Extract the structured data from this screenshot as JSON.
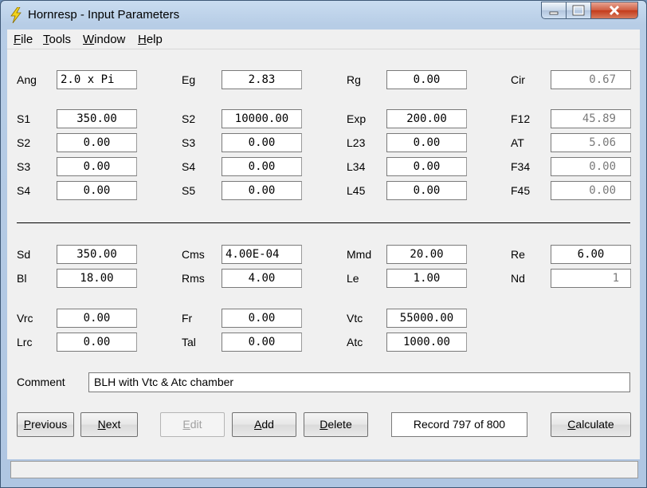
{
  "window": {
    "title": "Hornresp - Input Parameters"
  },
  "menu": [
    {
      "key": "F",
      "rest": "ile"
    },
    {
      "key": "T",
      "rest": "ools"
    },
    {
      "key": "W",
      "rest": "indow"
    },
    {
      "key": "H",
      "rest": "elp"
    }
  ],
  "fields": {
    "ang": {
      "label": "Ang",
      "value": "2.0 x Pi"
    },
    "eg": {
      "label": "Eg",
      "value": "2.83"
    },
    "rg": {
      "label": "Rg",
      "value": "0.00"
    },
    "cir": {
      "label": "Cir",
      "value": "0.67"
    },
    "s1": {
      "label": "S1",
      "value": "350.00"
    },
    "s2a": {
      "label": "S2",
      "value": "10000.00"
    },
    "exp": {
      "label": "Exp",
      "value": "200.00"
    },
    "f12": {
      "label": "F12",
      "value": "45.89"
    },
    "s2": {
      "label": "S2",
      "value": "0.00"
    },
    "s3a": {
      "label": "S3",
      "value": "0.00"
    },
    "l23": {
      "label": "L23",
      "value": "0.00"
    },
    "at": {
      "label": "AT",
      "value": "5.06"
    },
    "s3": {
      "label": "S3",
      "value": "0.00"
    },
    "s4a": {
      "label": "S4",
      "value": "0.00"
    },
    "l34": {
      "label": "L34",
      "value": "0.00"
    },
    "f34": {
      "label": "F34",
      "value": "0.00"
    },
    "s4": {
      "label": "S4",
      "value": "0.00"
    },
    "s5": {
      "label": "S5",
      "value": "0.00"
    },
    "l45": {
      "label": "L45",
      "value": "0.00"
    },
    "f45": {
      "label": "F45",
      "value": "0.00"
    },
    "sd": {
      "label": "Sd",
      "value": "350.00"
    },
    "cms": {
      "label": "Cms",
      "value": "4.00E-04"
    },
    "mmd": {
      "label": "Mmd",
      "value": "20.00"
    },
    "re": {
      "label": "Re",
      "value": "6.00"
    },
    "bl": {
      "label": "Bl",
      "value": "18.00"
    },
    "rms": {
      "label": "Rms",
      "value": "4.00"
    },
    "le": {
      "label": "Le",
      "value": "1.00"
    },
    "nd": {
      "label": "Nd",
      "value": "1"
    },
    "vrc": {
      "label": "Vrc",
      "value": "0.00"
    },
    "fr": {
      "label": "Fr",
      "value": "0.00"
    },
    "vtc": {
      "label": "Vtc",
      "value": "55000.00"
    },
    "lrc": {
      "label": "Lrc",
      "value": "0.00"
    },
    "tal": {
      "label": "Tal",
      "value": "0.00"
    },
    "atc": {
      "label": "Atc",
      "value": "1000.00"
    }
  },
  "comment": {
    "label": "Comment",
    "value": "BLH with Vtc & Atc chamber"
  },
  "buttons": {
    "previous": {
      "key": "P",
      "rest": "revious"
    },
    "next": {
      "key": "N",
      "rest": "ext"
    },
    "edit": {
      "key": "E",
      "rest": "dit"
    },
    "add": {
      "key": "A",
      "rest": "dd"
    },
    "delete": {
      "key": "D",
      "rest": "elete"
    },
    "calculate": {
      "key": "C",
      "rest": "alculate"
    }
  },
  "record": "Record 797 of 800",
  "icons": {
    "app": "lightning-bolt-icon",
    "minimize": "minimize-icon",
    "maximize": "maximize-icon",
    "close": "close-icon"
  },
  "colors": {
    "readonly_text": "#7a7a7a",
    "close_button": "#c43b1b"
  }
}
